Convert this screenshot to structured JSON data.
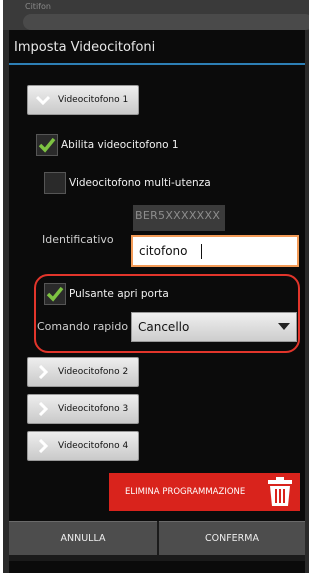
{
  "topbar": {
    "ghost_text": "Citifon"
  },
  "dialog": {
    "title": "Imposta Videocitofoni"
  },
  "sections": [
    {
      "label": "Videocitofono 1",
      "expanded": true
    },
    {
      "label": "Videocitofono 2",
      "expanded": false
    },
    {
      "label": "Videocitofono 3",
      "expanded": false
    },
    {
      "label": "Videocitofono 4",
      "expanded": false
    }
  ],
  "videocitofono1": {
    "enable_label": "Abilita videocitofono 1",
    "enable_checked": true,
    "multiuser_label": "Videocitofono multi-utenza",
    "multiuser_checked": false,
    "identifier_label": "Identificativo",
    "identifier_code": "BER5XXXXXXX",
    "identifier_value": "citofono",
    "door_button_label": "Pulsante apri porta",
    "door_button_checked": true,
    "quick_command_label": "Comando rapido",
    "quick_command_value": "Cancello"
  },
  "actions": {
    "delete_label": "ELIMINA PROGRAMMAZIONE",
    "cancel_label": "ANNULLA",
    "confirm_label": "CONFERMA"
  },
  "colors": {
    "accent_blue": "#2d7fb5",
    "check_green": "#7dc242",
    "input_border": "#f39b57",
    "highlight_red": "#e2352b",
    "delete_red": "#d9231c"
  },
  "icons": {
    "check": "check-icon",
    "chevron_down": "chevron-down-icon",
    "chevron_right": "chevron-right-icon",
    "dropdown_arrow": "dropdown-arrow-icon",
    "trash": "trash-icon"
  }
}
